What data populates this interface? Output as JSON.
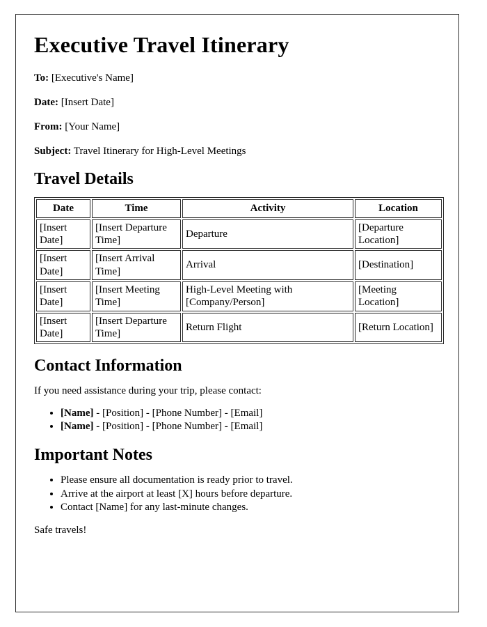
{
  "document": {
    "title": "Executive Travel Itinerary",
    "header_fields": [
      {
        "label": "To:",
        "value": "[Executive's Name]"
      },
      {
        "label": "Date:",
        "value": "[Insert Date]"
      },
      {
        "label": "From:",
        "value": "[Your Name]"
      },
      {
        "label": "Subject:",
        "value": "Travel Itinerary for High-Level Meetings"
      }
    ],
    "sections": {
      "travel_details": {
        "heading": "Travel Details",
        "table": {
          "columns": [
            "Date",
            "Time",
            "Activity",
            "Location"
          ],
          "rows": [
            {
              "date": "[Insert Date]",
              "time": "[Insert Departure Time]",
              "activity": "Departure",
              "location": "[Departure Location]"
            },
            {
              "date": "[Insert Date]",
              "time": "[Insert Arrival Time]",
              "activity": "Arrival",
              "location": "[Destination]"
            },
            {
              "date": "[Insert Date]",
              "time": "[Insert Meeting Time]",
              "activity": "High-Level Meeting with [Company/Person]",
              "location": "[Meeting Location]"
            },
            {
              "date": "[Insert Date]",
              "time": "[Insert Departure Time]",
              "activity": "Return Flight",
              "location": "[Return Location]"
            }
          ]
        }
      },
      "contact_information": {
        "heading": "Contact Information",
        "intro": "If you need assistance during your trip, please contact:",
        "contacts": [
          {
            "name": "[Name]",
            "rest": " - [Position] - [Phone Number] - [Email]"
          },
          {
            "name": "[Name]",
            "rest": " - [Position] - [Phone Number] - [Email]"
          }
        ]
      },
      "important_notes": {
        "heading": "Important Notes",
        "notes": [
          "Please ensure all documentation is ready prior to travel.",
          "Arrive at the airport at least [X] hours before departure.",
          "Contact [Name] for any last-minute changes."
        ],
        "closing": "Safe travels!"
      }
    }
  }
}
